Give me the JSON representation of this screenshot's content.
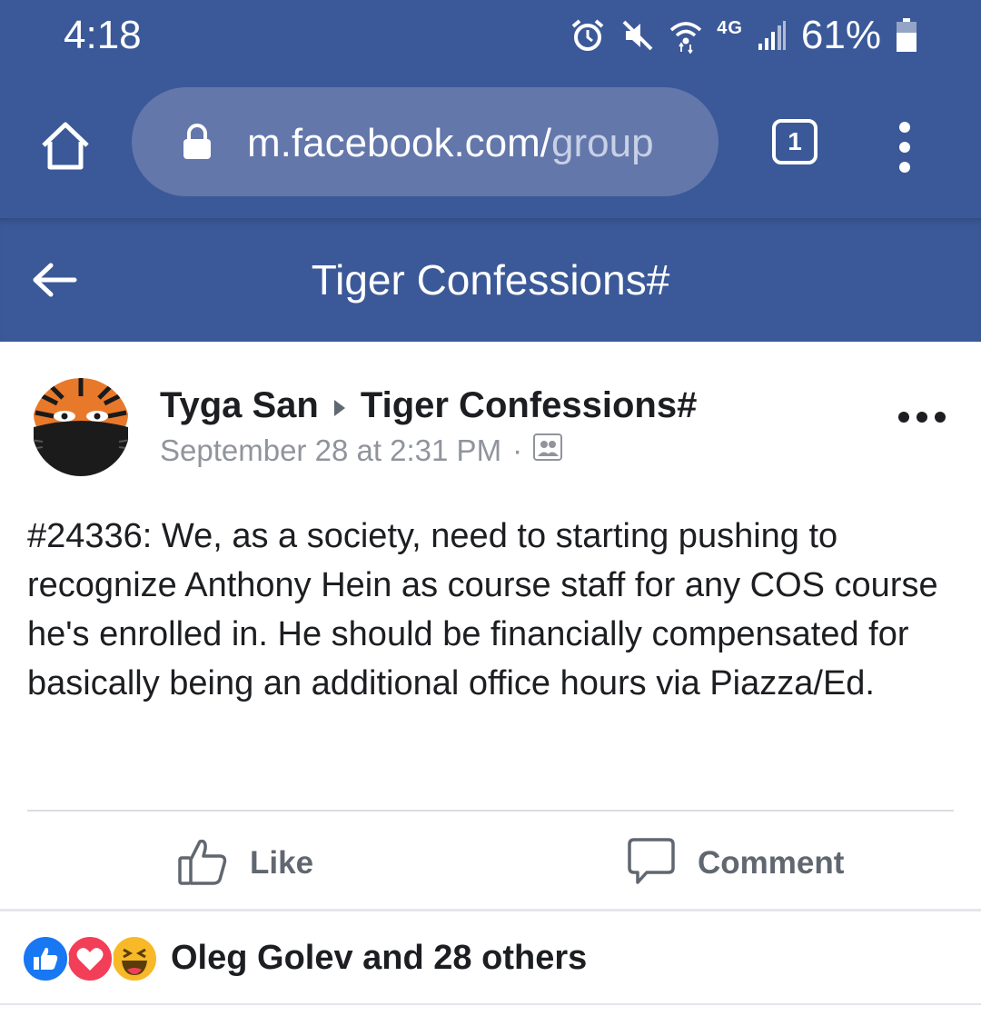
{
  "status_bar": {
    "time": "4:18",
    "network_label": "4G",
    "battery_percent": "61%",
    "icons": [
      "alarm-icon",
      "mute-icon",
      "wifi-icon",
      "signal-icon",
      "battery-icon"
    ]
  },
  "browser": {
    "home_icon": "home-icon",
    "url_main": "m.facebook.com/",
    "url_rest": "group",
    "tab_count": "1",
    "menu_icon": "more-vertical-icon"
  },
  "header": {
    "title": "Tiger Confessions#",
    "back_icon": "back-arrow-icon"
  },
  "post": {
    "author": "Tyga San",
    "group": "Tiger Confessions#",
    "timestamp": "September 28 at 2:31 PM",
    "separator": "·",
    "body": "#24336: We, as a society, need to starting pushing to recognize Anthony Hein as course staff for any COS course he's enrolled in. He should be financially compensated for basically being an additional office hours via Piazza/Ed.",
    "actions": {
      "like": "Like",
      "comment": "Comment"
    },
    "reactions": {
      "summary": "Oleg Golev and 28 others",
      "types": [
        "like",
        "love",
        "haha"
      ]
    }
  },
  "colors": {
    "brand": "#3b5998",
    "url_pill": "#6377ab",
    "text": "#1c1e21",
    "meta": "#90949c",
    "action": "#606770",
    "like_blue": "#1877f2",
    "love_red": "#f33e58",
    "haha_yellow": "#f7b928"
  }
}
